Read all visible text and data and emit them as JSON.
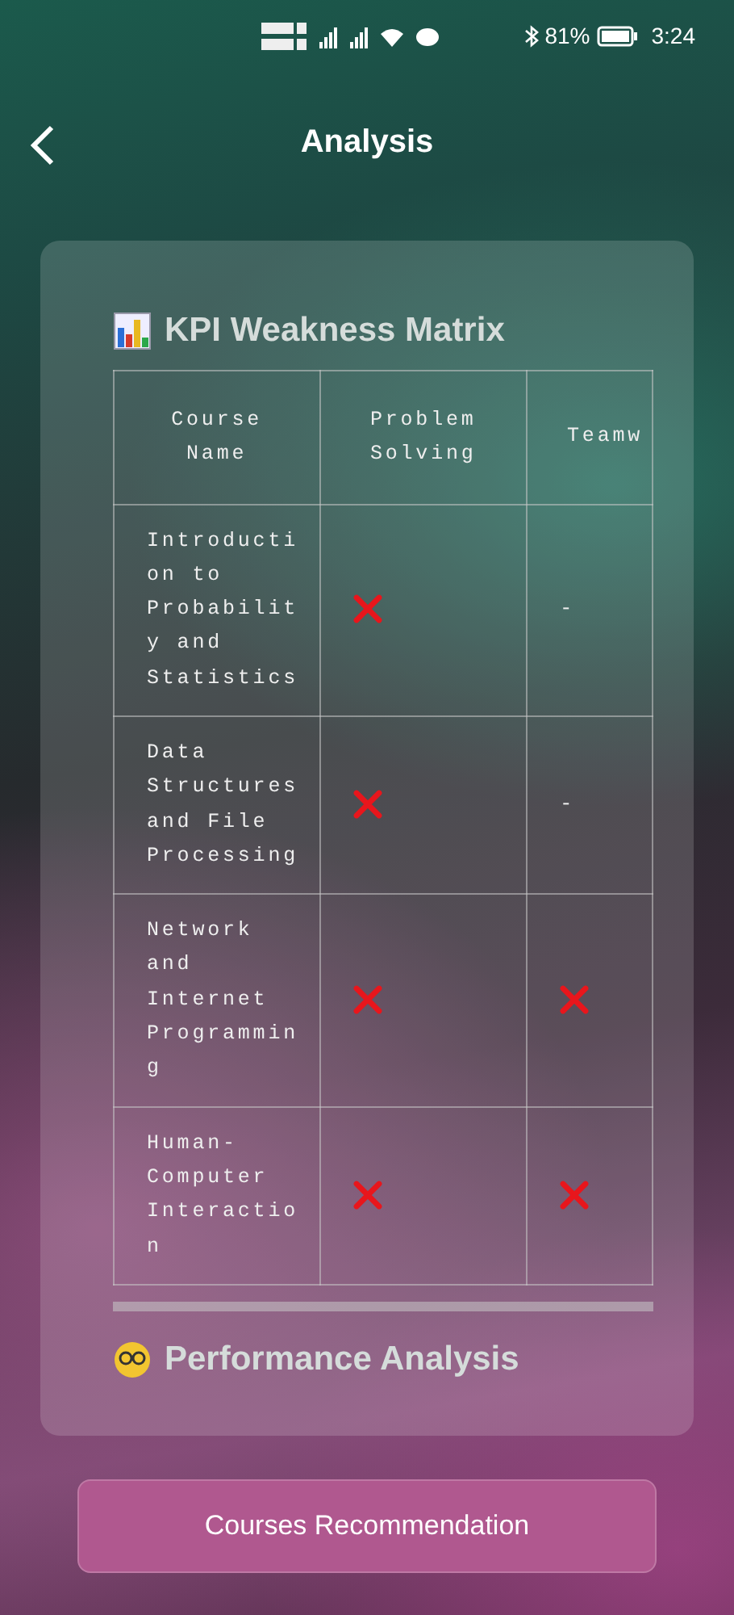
{
  "status_bar": {
    "battery": "81%",
    "time": "3:24"
  },
  "header": {
    "title": "Analysis"
  },
  "matrix": {
    "title": "KPI Weakness Matrix",
    "columns": [
      "Course Name",
      "Problem Solving",
      "Teamw"
    ],
    "rows": [
      {
        "course": "Introduction to Probability and Statistics",
        "cells": [
          {
            "kind": "cross"
          },
          {
            "kind": "text",
            "text": "-"
          }
        ]
      },
      {
        "course": "Data Structures and File Processing",
        "cells": [
          {
            "kind": "cross"
          },
          {
            "kind": "text",
            "text": "-"
          }
        ]
      },
      {
        "course": "Network and Internet Programming",
        "cells": [
          {
            "kind": "cross"
          },
          {
            "kind": "cross"
          }
        ]
      },
      {
        "course": "Human-Computer Interaction",
        "cells": [
          {
            "kind": "cross"
          },
          {
            "kind": "cross"
          }
        ]
      }
    ]
  },
  "next_section": {
    "title": "Performance Analysis"
  },
  "button": "Courses Recommendation"
}
